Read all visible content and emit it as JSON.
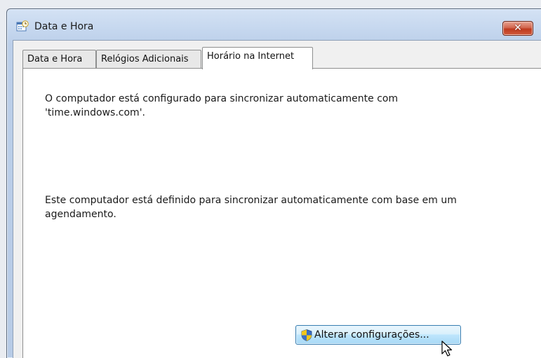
{
  "window": {
    "title": "Data e Hora",
    "close_symbol": "✕"
  },
  "tabs": [
    {
      "label": "Data e Hora",
      "active": false
    },
    {
      "label": "Relógios Adicionais",
      "active": false
    },
    {
      "label": "Horário na Internet",
      "active": true
    }
  ],
  "panel": {
    "sync_status": "O computador está configurado para sincronizar automaticamente com 'time.windows.com'.",
    "schedule_status": "Este computador está definido para sincronizar automaticamente com base em um agendamento.",
    "change_button_label": "Alterar configurações..."
  },
  "icons": {
    "title": "calendar-clock-icon",
    "button": "uac-shield-icon",
    "cursor": "mouse-pointer-icon"
  },
  "colors": {
    "close_button": "#c7432a",
    "titlebar": "#c9daf0",
    "button_highlight": "#bee6fd"
  }
}
